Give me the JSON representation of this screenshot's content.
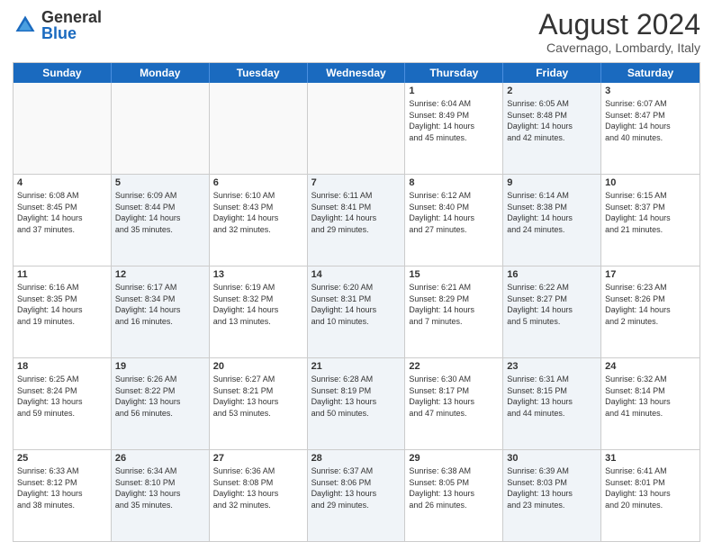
{
  "header": {
    "logo_general": "General",
    "logo_blue": "Blue",
    "month_year": "August 2024",
    "location": "Cavernago, Lombardy, Italy"
  },
  "days_of_week": [
    "Sunday",
    "Monday",
    "Tuesday",
    "Wednesday",
    "Thursday",
    "Friday",
    "Saturday"
  ],
  "weeks": [
    [
      {
        "day": "",
        "info": ""
      },
      {
        "day": "",
        "info": ""
      },
      {
        "day": "",
        "info": ""
      },
      {
        "day": "",
        "info": ""
      },
      {
        "day": "1",
        "info": "Sunrise: 6:04 AM\nSunset: 8:49 PM\nDaylight: 14 hours\nand 45 minutes."
      },
      {
        "day": "2",
        "info": "Sunrise: 6:05 AM\nSunset: 8:48 PM\nDaylight: 14 hours\nand 42 minutes."
      },
      {
        "day": "3",
        "info": "Sunrise: 6:07 AM\nSunset: 8:47 PM\nDaylight: 14 hours\nand 40 minutes."
      }
    ],
    [
      {
        "day": "4",
        "info": "Sunrise: 6:08 AM\nSunset: 8:45 PM\nDaylight: 14 hours\nand 37 minutes."
      },
      {
        "day": "5",
        "info": "Sunrise: 6:09 AM\nSunset: 8:44 PM\nDaylight: 14 hours\nand 35 minutes."
      },
      {
        "day": "6",
        "info": "Sunrise: 6:10 AM\nSunset: 8:43 PM\nDaylight: 14 hours\nand 32 minutes."
      },
      {
        "day": "7",
        "info": "Sunrise: 6:11 AM\nSunset: 8:41 PM\nDaylight: 14 hours\nand 29 minutes."
      },
      {
        "day": "8",
        "info": "Sunrise: 6:12 AM\nSunset: 8:40 PM\nDaylight: 14 hours\nand 27 minutes."
      },
      {
        "day": "9",
        "info": "Sunrise: 6:14 AM\nSunset: 8:38 PM\nDaylight: 14 hours\nand 24 minutes."
      },
      {
        "day": "10",
        "info": "Sunrise: 6:15 AM\nSunset: 8:37 PM\nDaylight: 14 hours\nand 21 minutes."
      }
    ],
    [
      {
        "day": "11",
        "info": "Sunrise: 6:16 AM\nSunset: 8:35 PM\nDaylight: 14 hours\nand 19 minutes."
      },
      {
        "day": "12",
        "info": "Sunrise: 6:17 AM\nSunset: 8:34 PM\nDaylight: 14 hours\nand 16 minutes."
      },
      {
        "day": "13",
        "info": "Sunrise: 6:19 AM\nSunset: 8:32 PM\nDaylight: 14 hours\nand 13 minutes."
      },
      {
        "day": "14",
        "info": "Sunrise: 6:20 AM\nSunset: 8:31 PM\nDaylight: 14 hours\nand 10 minutes."
      },
      {
        "day": "15",
        "info": "Sunrise: 6:21 AM\nSunset: 8:29 PM\nDaylight: 14 hours\nand 7 minutes."
      },
      {
        "day": "16",
        "info": "Sunrise: 6:22 AM\nSunset: 8:27 PM\nDaylight: 14 hours\nand 5 minutes."
      },
      {
        "day": "17",
        "info": "Sunrise: 6:23 AM\nSunset: 8:26 PM\nDaylight: 14 hours\nand 2 minutes."
      }
    ],
    [
      {
        "day": "18",
        "info": "Sunrise: 6:25 AM\nSunset: 8:24 PM\nDaylight: 13 hours\nand 59 minutes."
      },
      {
        "day": "19",
        "info": "Sunrise: 6:26 AM\nSunset: 8:22 PM\nDaylight: 13 hours\nand 56 minutes."
      },
      {
        "day": "20",
        "info": "Sunrise: 6:27 AM\nSunset: 8:21 PM\nDaylight: 13 hours\nand 53 minutes."
      },
      {
        "day": "21",
        "info": "Sunrise: 6:28 AM\nSunset: 8:19 PM\nDaylight: 13 hours\nand 50 minutes."
      },
      {
        "day": "22",
        "info": "Sunrise: 6:30 AM\nSunset: 8:17 PM\nDaylight: 13 hours\nand 47 minutes."
      },
      {
        "day": "23",
        "info": "Sunrise: 6:31 AM\nSunset: 8:15 PM\nDaylight: 13 hours\nand 44 minutes."
      },
      {
        "day": "24",
        "info": "Sunrise: 6:32 AM\nSunset: 8:14 PM\nDaylight: 13 hours\nand 41 minutes."
      }
    ],
    [
      {
        "day": "25",
        "info": "Sunrise: 6:33 AM\nSunset: 8:12 PM\nDaylight: 13 hours\nand 38 minutes."
      },
      {
        "day": "26",
        "info": "Sunrise: 6:34 AM\nSunset: 8:10 PM\nDaylight: 13 hours\nand 35 minutes."
      },
      {
        "day": "27",
        "info": "Sunrise: 6:36 AM\nSunset: 8:08 PM\nDaylight: 13 hours\nand 32 minutes."
      },
      {
        "day": "28",
        "info": "Sunrise: 6:37 AM\nSunset: 8:06 PM\nDaylight: 13 hours\nand 29 minutes."
      },
      {
        "day": "29",
        "info": "Sunrise: 6:38 AM\nSunset: 8:05 PM\nDaylight: 13 hours\nand 26 minutes."
      },
      {
        "day": "30",
        "info": "Sunrise: 6:39 AM\nSunset: 8:03 PM\nDaylight: 13 hours\nand 23 minutes."
      },
      {
        "day": "31",
        "info": "Sunrise: 6:41 AM\nSunset: 8:01 PM\nDaylight: 13 hours\nand 20 minutes."
      }
    ]
  ]
}
